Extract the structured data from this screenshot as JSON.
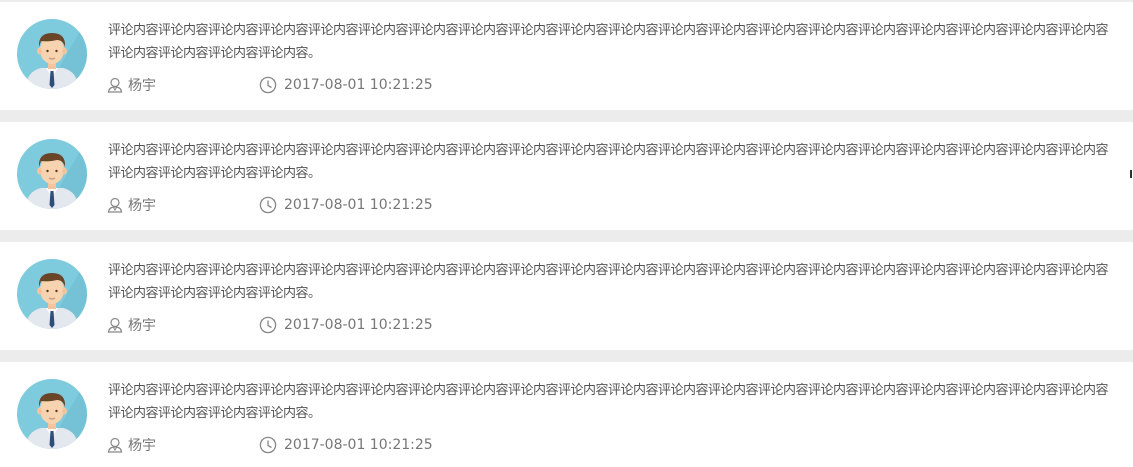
{
  "comments": [
    {
      "text": "评论内容评论内容评论内容评论内容评论内容评论内容评论内容评论内容评论内容评论内容评论内容评论内容评论内容评论内容评论内容评论内容评论内容评论内容评论内容评论内容评论内容评论内容评论内容评论内容。",
      "author": "杨宇",
      "time": "2017-08-01 10:21:25"
    },
    {
      "text": "评论内容评论内容评论内容评论内容评论内容评论内容评论内容评论内容评论内容评论内容评论内容评论内容评论内容评论内容评论内容评论内容评论内容评论内容评论内容评论内容评论内容评论内容评论内容评论内容。",
      "author": "杨宇",
      "time": "2017-08-01 10:21:25"
    },
    {
      "text": "评论内容评论内容评论内容评论内容评论内容评论内容评论内容评论内容评论内容评论内容评论内容评论内容评论内容评论内容评论内容评论内容评论内容评论内容评论内容评论内容评论内容评论内容评论内容评论内容。",
      "author": "杨宇",
      "time": "2017-08-01 10:21:25"
    },
    {
      "text": "评论内容评论内容评论内容评论内容评论内容评论内容评论内容评论内容评论内容评论内容评论内容评论内容评论内容评论内容评论内容评论内容评论内容评论内容评论内容评论内容评论内容评论内容评论内容评论内容。",
      "author": "杨宇",
      "time": "2017-08-01 10:21:25"
    }
  ],
  "icons": {
    "avatar": "male-avatar-icon",
    "user": "user-icon",
    "time": "clock-icon"
  },
  "colors": {
    "page_background": "#ececec",
    "card_background": "#ffffff",
    "avatar_background": "#7ecbde",
    "text": "#555555",
    "meta_text": "#777777"
  }
}
